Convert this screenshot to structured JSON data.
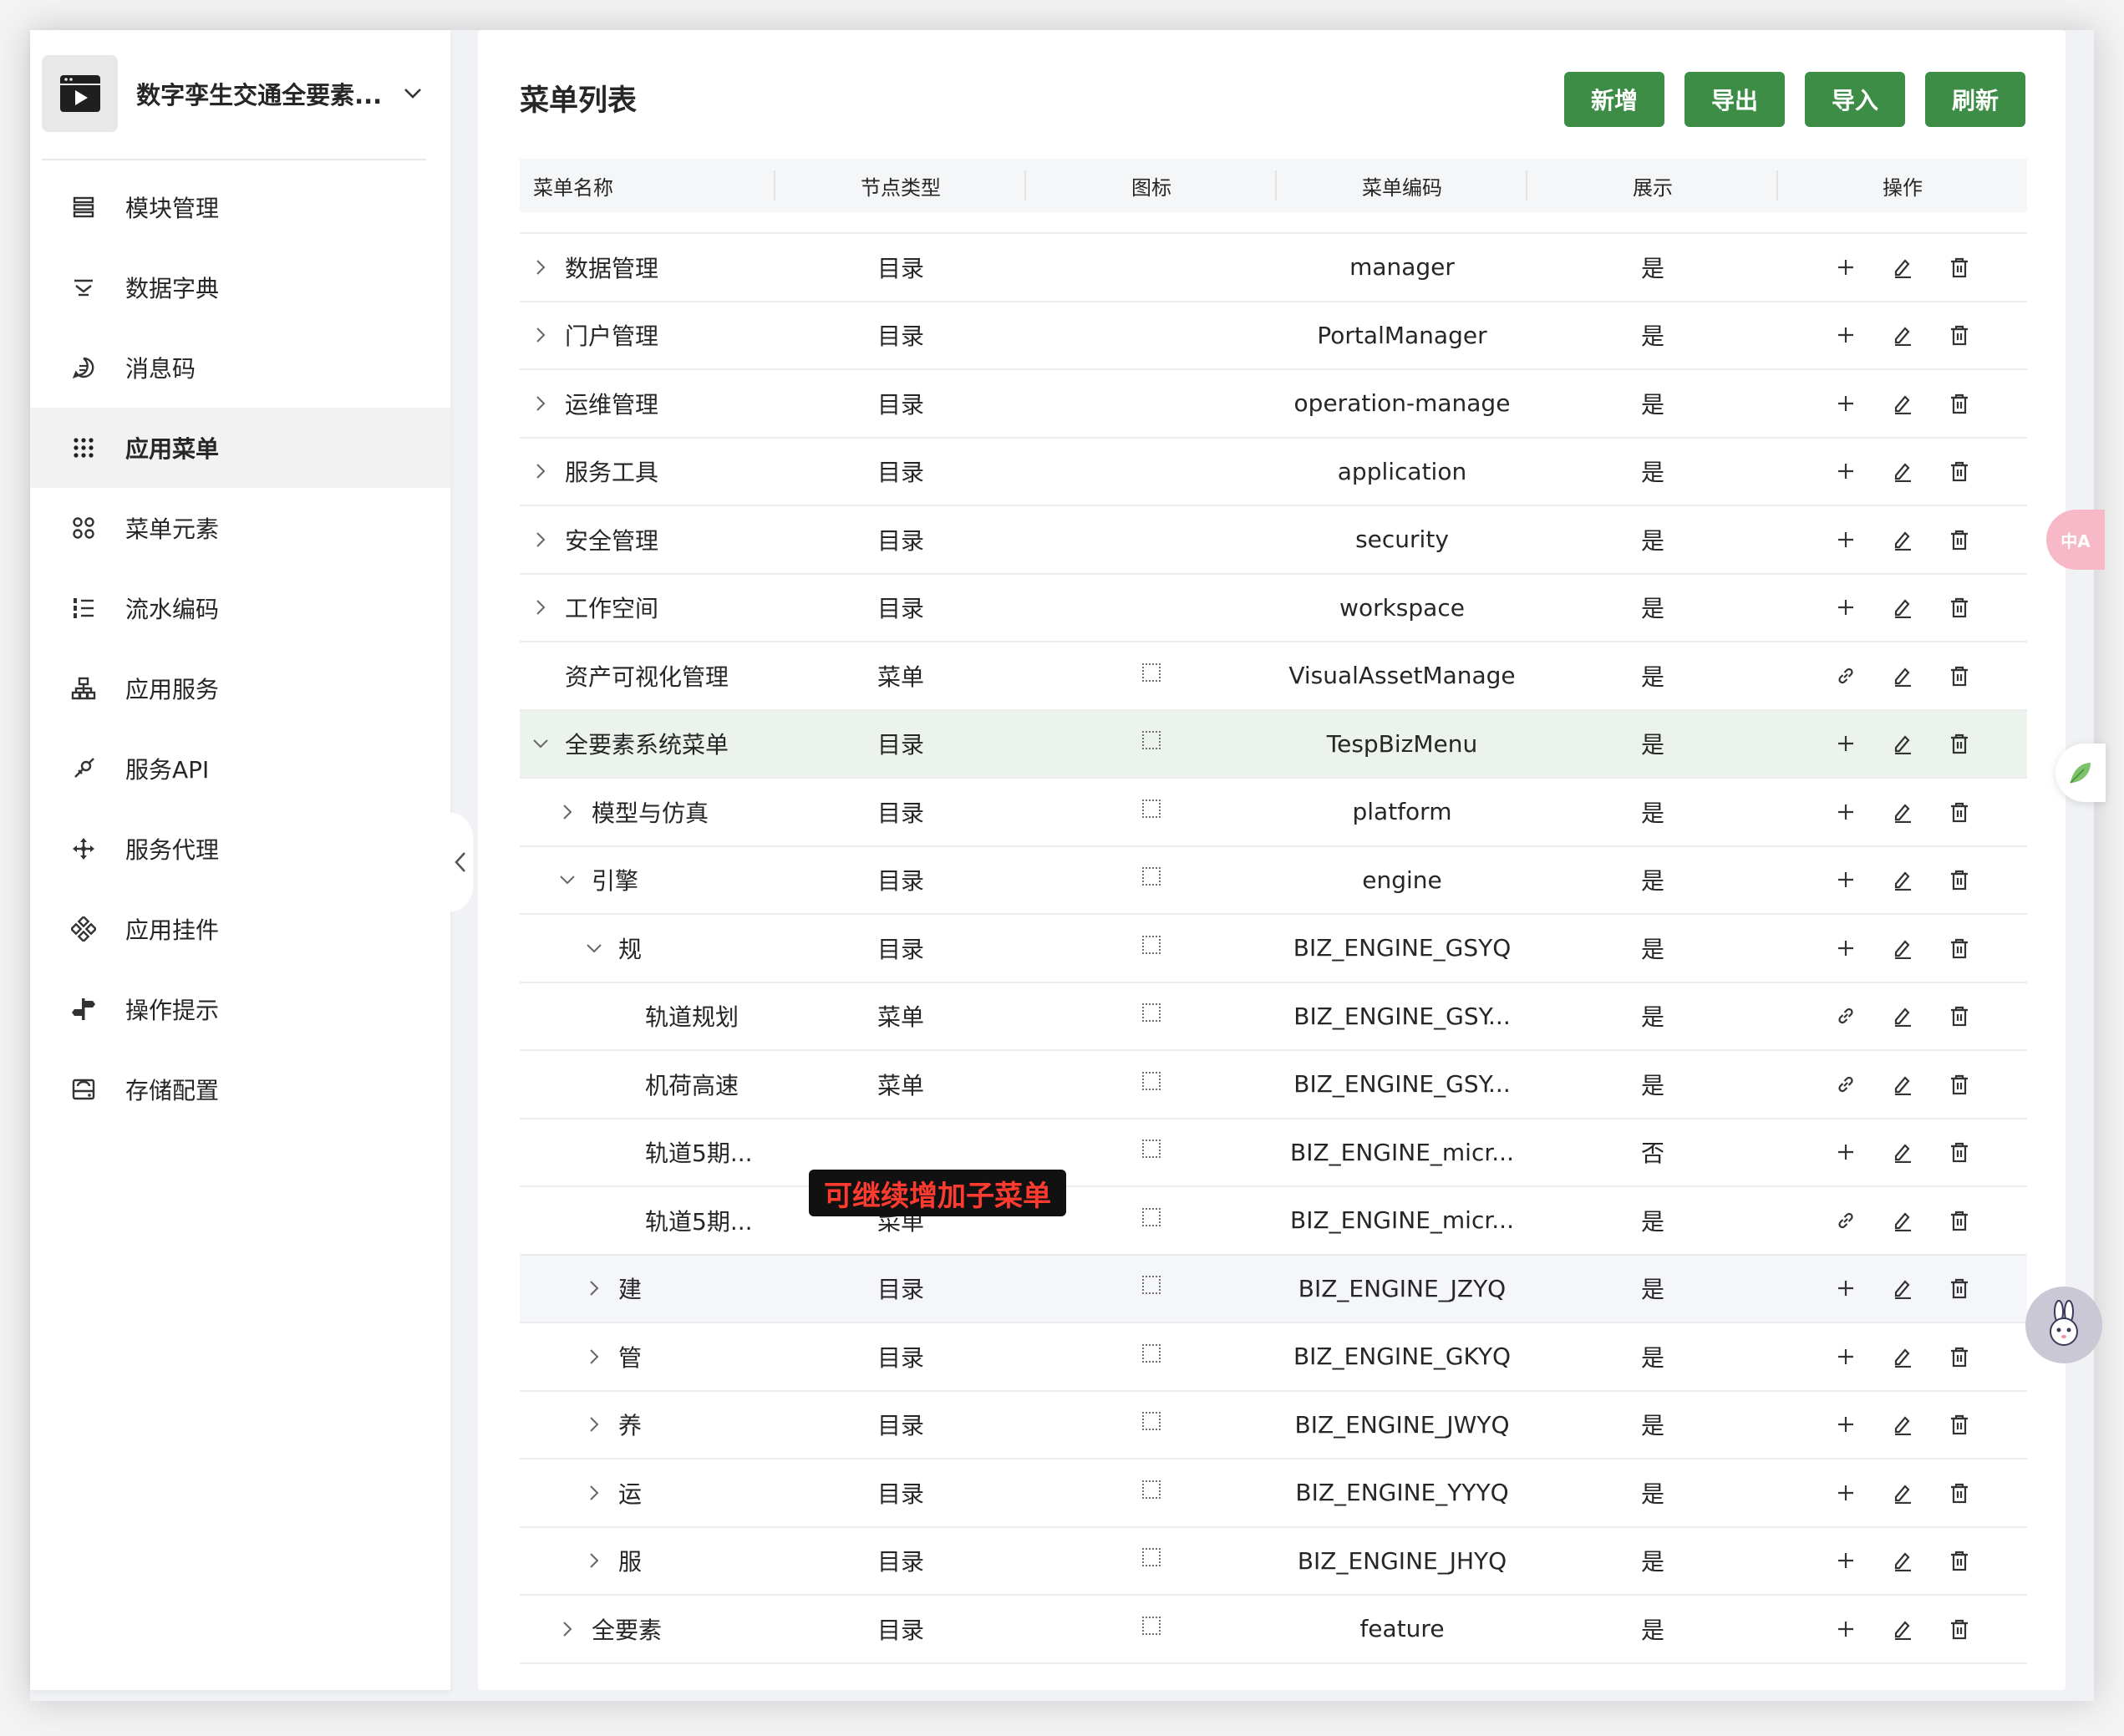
{
  "app": {
    "title": "数字孪生交通全要素..."
  },
  "sidebar": {
    "items": [
      {
        "label": "模块管理",
        "icon": "list-icon",
        "active": false
      },
      {
        "label": "数据字典",
        "icon": "filter-icon",
        "active": false
      },
      {
        "label": "消息码",
        "icon": "message-icon",
        "active": false
      },
      {
        "label": "应用菜单",
        "icon": "apps-grid-icon",
        "active": true
      },
      {
        "label": "菜单元素",
        "icon": "elements-icon",
        "active": false
      },
      {
        "label": "流水编码",
        "icon": "ordered-list-icon",
        "active": false
      },
      {
        "label": "应用服务",
        "icon": "cluster-icon",
        "active": false
      },
      {
        "label": "服务API",
        "icon": "api-icon",
        "active": false
      },
      {
        "label": "服务代理",
        "icon": "proxy-icon",
        "active": false
      },
      {
        "label": "应用挂件",
        "icon": "widget-icon",
        "active": false
      },
      {
        "label": "操作提示",
        "icon": "signpost-icon",
        "active": false
      },
      {
        "label": "存储配置",
        "icon": "storage-icon",
        "active": false
      }
    ]
  },
  "main": {
    "title": "菜单列表",
    "buttons": {
      "add": "新增",
      "export": "导出",
      "import": "导入",
      "refresh": "刷新"
    },
    "columns": [
      "菜单名称",
      "节点类型",
      "图标",
      "菜单编码",
      "展示",
      "操作"
    ],
    "rows": [
      {
        "name": "数据管理",
        "level": 0,
        "expander": "right",
        "type": "目录",
        "icon": false,
        "code": "manager",
        "show": "是",
        "first_op": "plus"
      },
      {
        "name": "门户管理",
        "level": 0,
        "expander": "right",
        "type": "目录",
        "icon": false,
        "code": "PortalManager",
        "show": "是",
        "first_op": "plus"
      },
      {
        "name": "运维管理",
        "level": 0,
        "expander": "right",
        "type": "目录",
        "icon": false,
        "code": "operation-manage",
        "show": "是",
        "first_op": "plus"
      },
      {
        "name": "服务工具",
        "level": 0,
        "expander": "right",
        "type": "目录",
        "icon": false,
        "code": "application",
        "show": "是",
        "first_op": "plus"
      },
      {
        "name": "安全管理",
        "level": 0,
        "expander": "right",
        "type": "目录",
        "icon": false,
        "code": "security",
        "show": "是",
        "first_op": "plus"
      },
      {
        "name": "工作空间",
        "level": 0,
        "expander": "right",
        "type": "目录",
        "icon": false,
        "code": "workspace",
        "show": "是",
        "first_op": "plus"
      },
      {
        "name": "资产可视化管理",
        "level": 0,
        "expander": "none",
        "type": "菜单",
        "icon": true,
        "code": "VisualAssetManage",
        "show": "是",
        "first_op": "link"
      },
      {
        "name": "全要素系统菜单",
        "level": 0,
        "expander": "down",
        "type": "目录",
        "icon": true,
        "code": "TespBizMenu",
        "show": "是",
        "first_op": "plus",
        "state": "selected"
      },
      {
        "name": "模型与仿真",
        "level": 1,
        "expander": "right",
        "type": "目录",
        "icon": true,
        "code": "platform",
        "show": "是",
        "first_op": "plus"
      },
      {
        "name": "引擎",
        "level": 1,
        "expander": "down",
        "type": "目录",
        "icon": true,
        "code": "engine",
        "show": "是",
        "first_op": "plus"
      },
      {
        "name": "规",
        "level": 2,
        "expander": "down",
        "type": "目录",
        "icon": true,
        "code": "BIZ_ENGINE_GSYQ",
        "show": "是",
        "first_op": "plus"
      },
      {
        "name": "轨道规划",
        "level": 3,
        "expander": "none",
        "type": "菜单",
        "icon": true,
        "code": "BIZ_ENGINE_GSY...",
        "show": "是",
        "first_op": "link"
      },
      {
        "name": "机荷高速",
        "level": 3,
        "expander": "none",
        "type": "菜单",
        "icon": true,
        "code": "BIZ_ENGINE_GSY...",
        "show": "是",
        "first_op": "link"
      },
      {
        "name": "轨道5期...",
        "level": 3,
        "expander": "none",
        "type": "",
        "icon": true,
        "code": "BIZ_ENGINE_micr...",
        "show": "否",
        "first_op": "plus"
      },
      {
        "name": "轨道5期...",
        "level": 3,
        "expander": "none",
        "type": "菜单",
        "icon": true,
        "code": "BIZ_ENGINE_micr...",
        "show": "是",
        "first_op": "link"
      },
      {
        "name": "建",
        "level": 2,
        "expander": "right",
        "type": "目录",
        "icon": true,
        "code": "BIZ_ENGINE_JZYQ",
        "show": "是",
        "first_op": "plus",
        "state": "hover"
      },
      {
        "name": "管",
        "level": 2,
        "expander": "right",
        "type": "目录",
        "icon": true,
        "code": "BIZ_ENGINE_GKYQ",
        "show": "是",
        "first_op": "plus"
      },
      {
        "name": "养",
        "level": 2,
        "expander": "right",
        "type": "目录",
        "icon": true,
        "code": "BIZ_ENGINE_JWYQ",
        "show": "是",
        "first_op": "plus"
      },
      {
        "name": "运",
        "level": 2,
        "expander": "right",
        "type": "目录",
        "icon": true,
        "code": "BIZ_ENGINE_YYYQ",
        "show": "是",
        "first_op": "plus"
      },
      {
        "name": "服",
        "level": 2,
        "expander": "right",
        "type": "目录",
        "icon": true,
        "code": "BIZ_ENGINE_JHYQ",
        "show": "是",
        "first_op": "plus"
      },
      {
        "name": "全要素",
        "level": 1,
        "expander": "right",
        "type": "目录",
        "icon": true,
        "code": "feature",
        "show": "是",
        "first_op": "plus"
      }
    ],
    "annotation": "可继续增加子菜单"
  },
  "floating": {
    "translate_label": "中A"
  },
  "colors": {
    "primary_button": "#3e8d46",
    "selected_row": "#ebf3ec",
    "annotation_text": "#ff3b30"
  }
}
